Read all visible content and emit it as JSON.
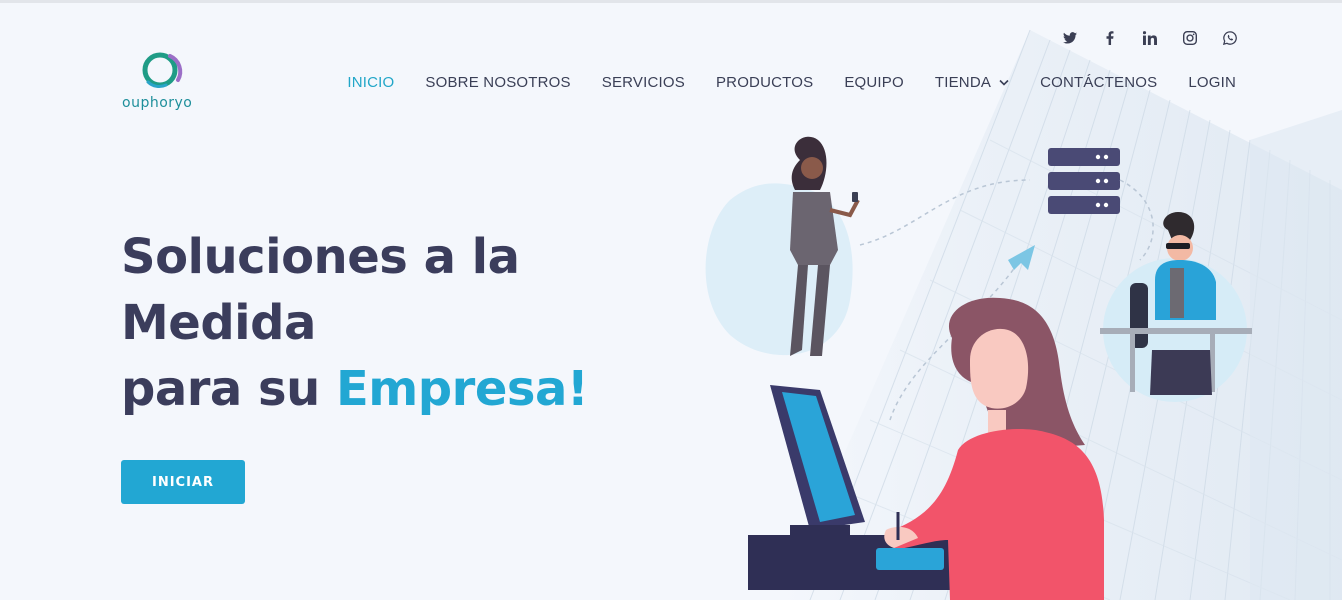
{
  "brand": {
    "name": "ouphoryo",
    "colors": {
      "primary": "#22a7d3",
      "heading": "#3b3d5c",
      "nav": "#3a3f56",
      "logo_green": "#1e8f9b"
    }
  },
  "social": [
    {
      "icon": "twitter-icon"
    },
    {
      "icon": "facebook-icon"
    },
    {
      "icon": "linkedin-icon"
    },
    {
      "icon": "instagram-icon"
    },
    {
      "icon": "whatsapp-icon"
    }
  ],
  "nav": {
    "items": [
      {
        "label": "INICIO",
        "active": true
      },
      {
        "label": "SOBRE NOSOTROS"
      },
      {
        "label": "SERVICIOS"
      },
      {
        "label": "PRODUCTOS"
      },
      {
        "label": "EQUIPO"
      },
      {
        "label": "TIENDA",
        "dropdown": true
      },
      {
        "label": "CONTÁCTENOS"
      },
      {
        "label": "LOGIN"
      }
    ]
  },
  "hero": {
    "line1": "Soluciones a la",
    "line2": "Medida",
    "line3_prefix": "para su ",
    "line3_accent": "Empresa!",
    "cta_label": "INICIAR"
  }
}
